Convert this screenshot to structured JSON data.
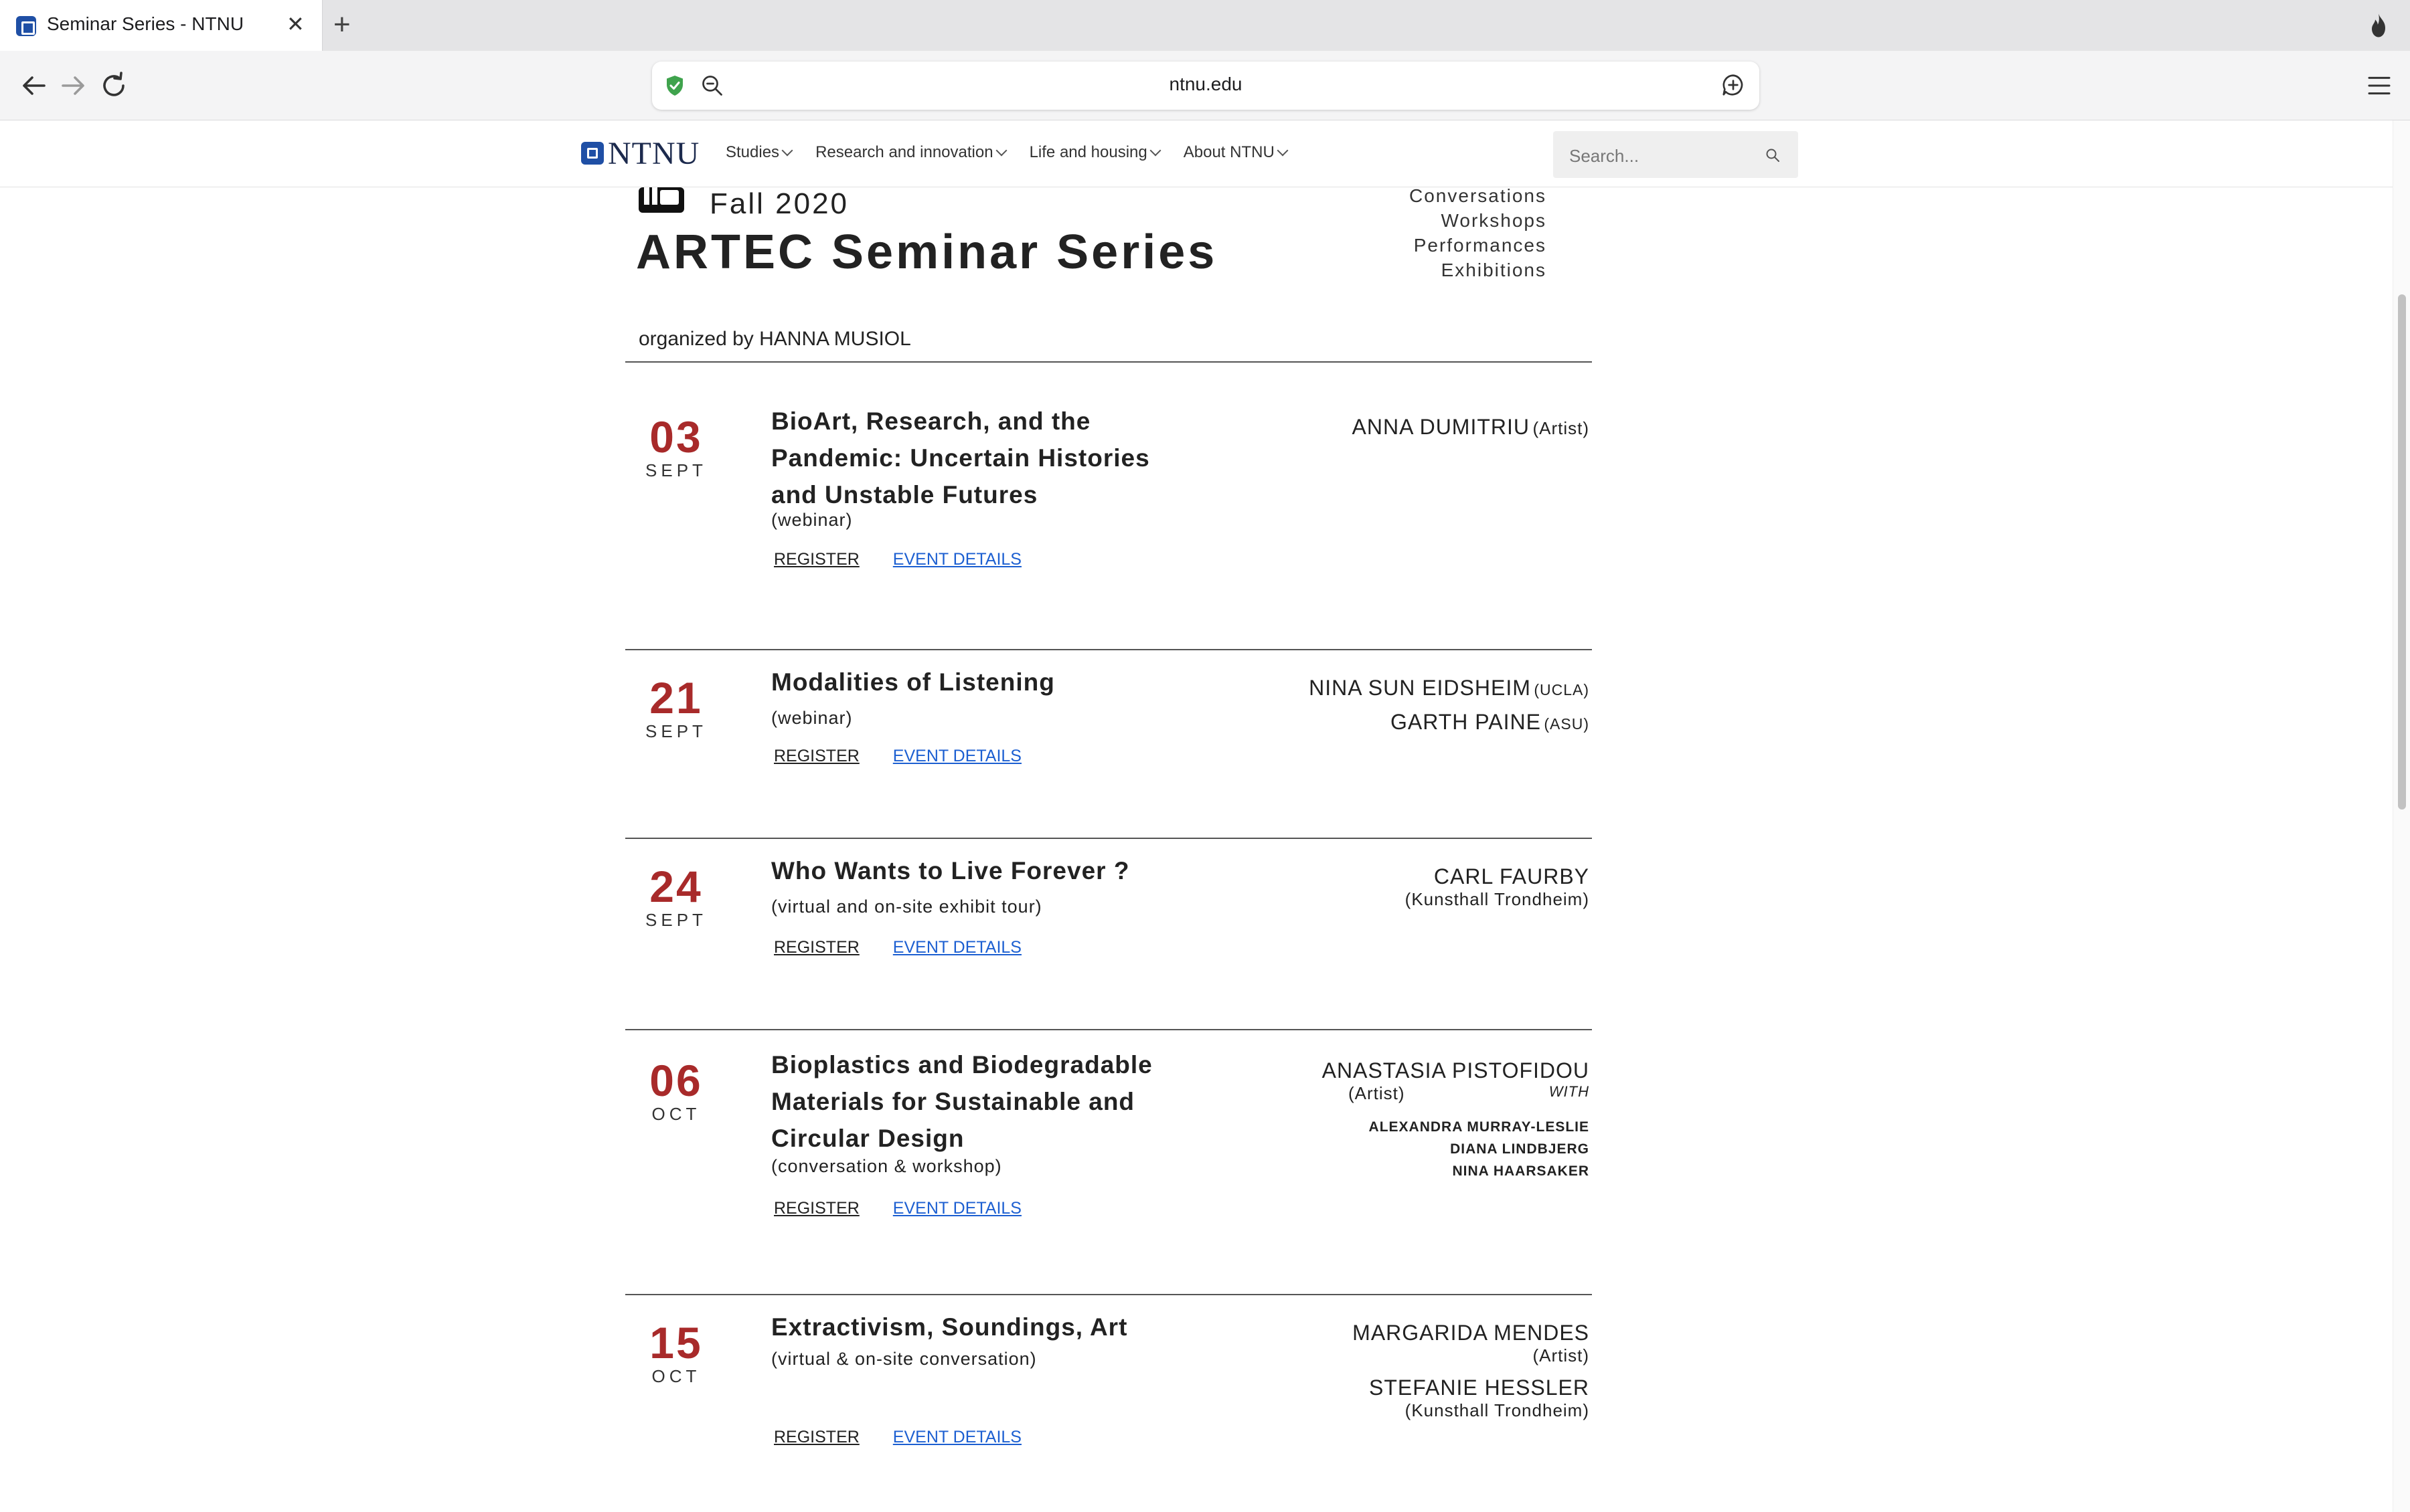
{
  "browser": {
    "tab_title": "Seminar Series - NTNU",
    "tab_close": "✕",
    "new_tab": "+",
    "url": "ntnu.edu"
  },
  "site": {
    "logo_text": "NTNU",
    "nav": [
      {
        "label": "Studies"
      },
      {
        "label": "Research and innovation"
      },
      {
        "label": "Life and housing"
      },
      {
        "label": "About NTNU"
      }
    ],
    "search_placeholder": "Search..."
  },
  "page": {
    "season": "Fall 2020",
    "title": "ARTEC Seminar Series",
    "formats": [
      "Conversations",
      "Workshops",
      "Performances",
      "Exhibitions"
    ],
    "organizer": "organized by HANNA MUSIOL",
    "register_label": "REGISTER",
    "details_label": "EVENT DETAILS"
  },
  "events": [
    {
      "day": "03",
      "month": "SEPT",
      "title": "BioArt, Research, and the Pandemic: Uncertain Histories and Unstable Futures",
      "format": "(webinar)",
      "people": [
        {
          "name": "ANNA DUMITRIU",
          "role": "(Artist)"
        }
      ]
    },
    {
      "day": "21",
      "month": "SEPT",
      "title": "Modalities of Listening",
      "format": "(webinar)",
      "people": [
        {
          "name": "NINA SUN EIDSHEIM",
          "role": "(UCLA)"
        },
        {
          "name": "GARTH PAINE",
          "role": "(ASU)"
        }
      ]
    },
    {
      "day": "24",
      "month": "SEPT",
      "title": "Who Wants to Live Forever ?",
      "format": "(virtual and on-site exhibit tour)",
      "people": [
        {
          "name": "CARL FAURBY",
          "role": "(Kunsthall Trondheim)"
        }
      ]
    },
    {
      "day": "06",
      "month": "OCT",
      "title": "Bioplastics and Biodegradable Materials for Sustainable and Circular Design",
      "format": "(conversation & workshop)",
      "people": [
        {
          "name": "ANASTASIA PISTOFIDOU",
          "role": "(Artist)",
          "with": "WITH"
        }
      ],
      "collaborators": [
        "ALEXANDRA MURRAY-LESLIE",
        "DIANA LINDBJERG",
        "NINA HAARSAKER"
      ]
    },
    {
      "day": "15",
      "month": "OCT",
      "title": "Extractivism, Soundings, Art",
      "format": "(virtual & on-site conversation)",
      "people": [
        {
          "name": "MARGARIDA MENDES",
          "role": "(Artist)"
        },
        {
          "name": "STEFANIE HESSLER",
          "role": "(Kunsthall Trondheim)"
        }
      ]
    }
  ],
  "colors": {
    "date_red": "#a82a2a",
    "link_blue": "#1c5fd1",
    "ntnu_blue": "#1f4fa5"
  }
}
